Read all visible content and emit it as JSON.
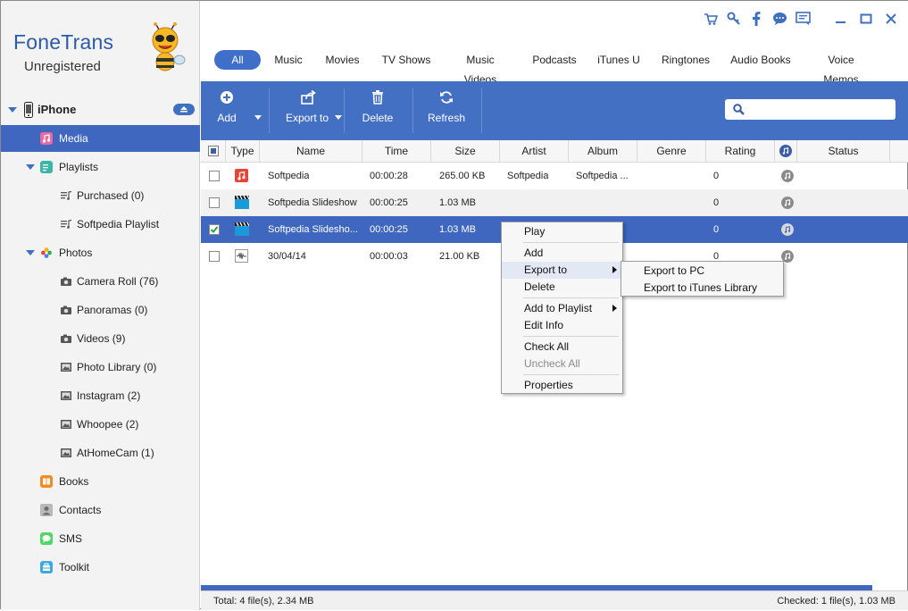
{
  "app": {
    "title": "FoneTrans",
    "subtitle": "Unregistered"
  },
  "device": {
    "name": "iPhone"
  },
  "sidebar": {
    "items": [
      {
        "label": "Media",
        "icon": "music-note-icon",
        "selected": true
      },
      {
        "label": "Playlists",
        "icon": "playlist-icon"
      },
      {
        "label": "Purchased (0)",
        "icon": "playlist-item-icon"
      },
      {
        "label": "Softpedia Playlist",
        "icon": "playlist-item-icon"
      },
      {
        "label": "Photos",
        "icon": "photos-flower-icon"
      },
      {
        "label": "Camera Roll (76)",
        "icon": "camera-icon"
      },
      {
        "label": "Panoramas (0)",
        "icon": "camera-icon"
      },
      {
        "label": "Videos (9)",
        "icon": "camera-icon"
      },
      {
        "label": "Photo Library (0)",
        "icon": "picture-icon"
      },
      {
        "label": "Instagram (2)",
        "icon": "picture-icon"
      },
      {
        "label": "Whoopee (2)",
        "icon": "picture-icon"
      },
      {
        "label": "AtHomeCam (1)",
        "icon": "picture-icon"
      },
      {
        "label": "Books",
        "icon": "books-icon"
      },
      {
        "label": "Contacts",
        "icon": "contacts-icon"
      },
      {
        "label": "SMS",
        "icon": "sms-icon"
      },
      {
        "label": "Toolkit",
        "icon": "toolkit-icon"
      }
    ]
  },
  "tabs": [
    "All",
    "Music",
    "Movies",
    "TV Shows",
    "Music Videos",
    "Podcasts",
    "iTunes U",
    "Ringtones",
    "Audio Books",
    "Voice Memos"
  ],
  "toolbar": {
    "add": "Add",
    "export": "Export to",
    "delete": "Delete",
    "refresh": "Refresh"
  },
  "table": {
    "headers": [
      "Type",
      "Name",
      "Time",
      "Size",
      "Artist",
      "Album",
      "Genre",
      "Rating",
      "Status"
    ],
    "rows": [
      {
        "type": "music",
        "name": "Softpedia",
        "time": "00:00:28",
        "size": "265.00 KB",
        "artist": "Softpedia",
        "album": "Softpedia ...",
        "genre": "",
        "rating": "0",
        "checked": false
      },
      {
        "type": "video",
        "name": "Softpedia Slideshow",
        "time": "00:00:25",
        "size": "1.03 MB",
        "artist": "",
        "album": "",
        "genre": "",
        "rating": "0",
        "checked": false
      },
      {
        "type": "video",
        "name": "Softpedia Slidesho...",
        "time": "00:00:25",
        "size": "1.03 MB",
        "artist": "",
        "album": "",
        "genre": "",
        "rating": "0",
        "checked": true
      },
      {
        "type": "voice",
        "name": "30/04/14",
        "time": "00:00:03",
        "size": "21.00 KB",
        "artist": "",
        "album": "",
        "genre": "",
        "rating": "0",
        "checked": false
      }
    ]
  },
  "context_menu": {
    "items": [
      "Play",
      "Add",
      "Export to",
      "Delete",
      "Add to Playlist",
      "Edit Info",
      "Check All",
      "Uncheck All",
      "Properties"
    ],
    "submenu": [
      "Export to PC",
      "Export to iTunes Library"
    ]
  },
  "status": {
    "total": "Total: 4 file(s), 2.34 MB",
    "checked": "Checked: 1 file(s), 1.03 MB"
  },
  "colors": {
    "accent": "#4470c4",
    "selected": "#3f67bf"
  }
}
